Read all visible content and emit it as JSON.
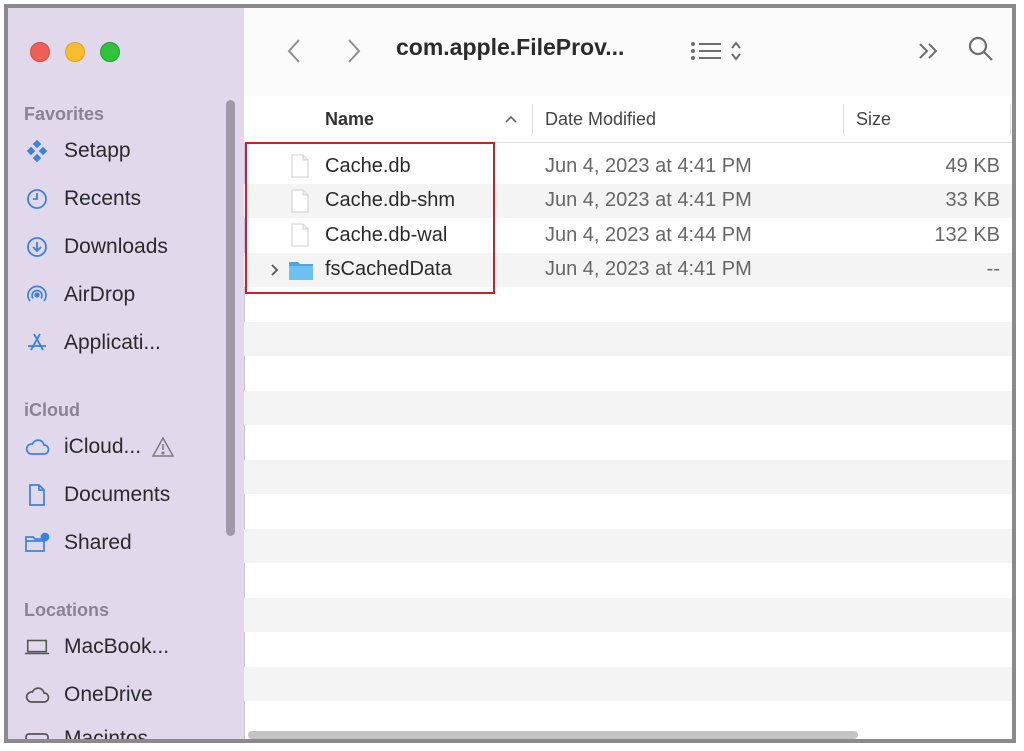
{
  "window": {
    "title": "com.apple.FileProv...",
    "accent_color": "#cc1f2d"
  },
  "sidebar": {
    "sections": [
      {
        "title": "Favorites"
      },
      {
        "title": "iCloud"
      },
      {
        "title": "Locations"
      }
    ],
    "items": [
      {
        "label": "Setapp",
        "icon": "setapp-icon"
      },
      {
        "label": "Recents",
        "icon": "clock-icon"
      },
      {
        "label": "Downloads",
        "icon": "download-icon"
      },
      {
        "label": "AirDrop",
        "icon": "airdrop-icon"
      },
      {
        "label": "Applicati...",
        "icon": "applications-icon"
      },
      {
        "label": "iCloud...",
        "icon": "cloud-icon"
      },
      {
        "label": "Documents",
        "icon": "document-icon"
      },
      {
        "label": "Shared",
        "icon": "shared-folder-icon"
      },
      {
        "label": "MacBook...",
        "icon": "laptop-icon"
      },
      {
        "label": "OneDrive",
        "icon": "cloud-icon"
      },
      {
        "label": "Macintos...",
        "icon": "disk-icon"
      }
    ]
  },
  "columns": {
    "name": "Name",
    "date": "Date Modified",
    "size": "Size"
  },
  "files": [
    {
      "name": "Cache.db",
      "date": "Jun 4, 2023 at 4:41 PM",
      "size": "49 KB",
      "type": "file"
    },
    {
      "name": "Cache.db-shm",
      "date": "Jun 4, 2023 at 4:41 PM",
      "size": "33 KB",
      "type": "file"
    },
    {
      "name": "Cache.db-wal",
      "date": "Jun 4, 2023 at 4:44 PM",
      "size": "132 KB",
      "type": "file"
    },
    {
      "name": "fsCachedData",
      "date": "Jun 4, 2023 at 4:41 PM",
      "size": "--",
      "type": "folder"
    }
  ]
}
